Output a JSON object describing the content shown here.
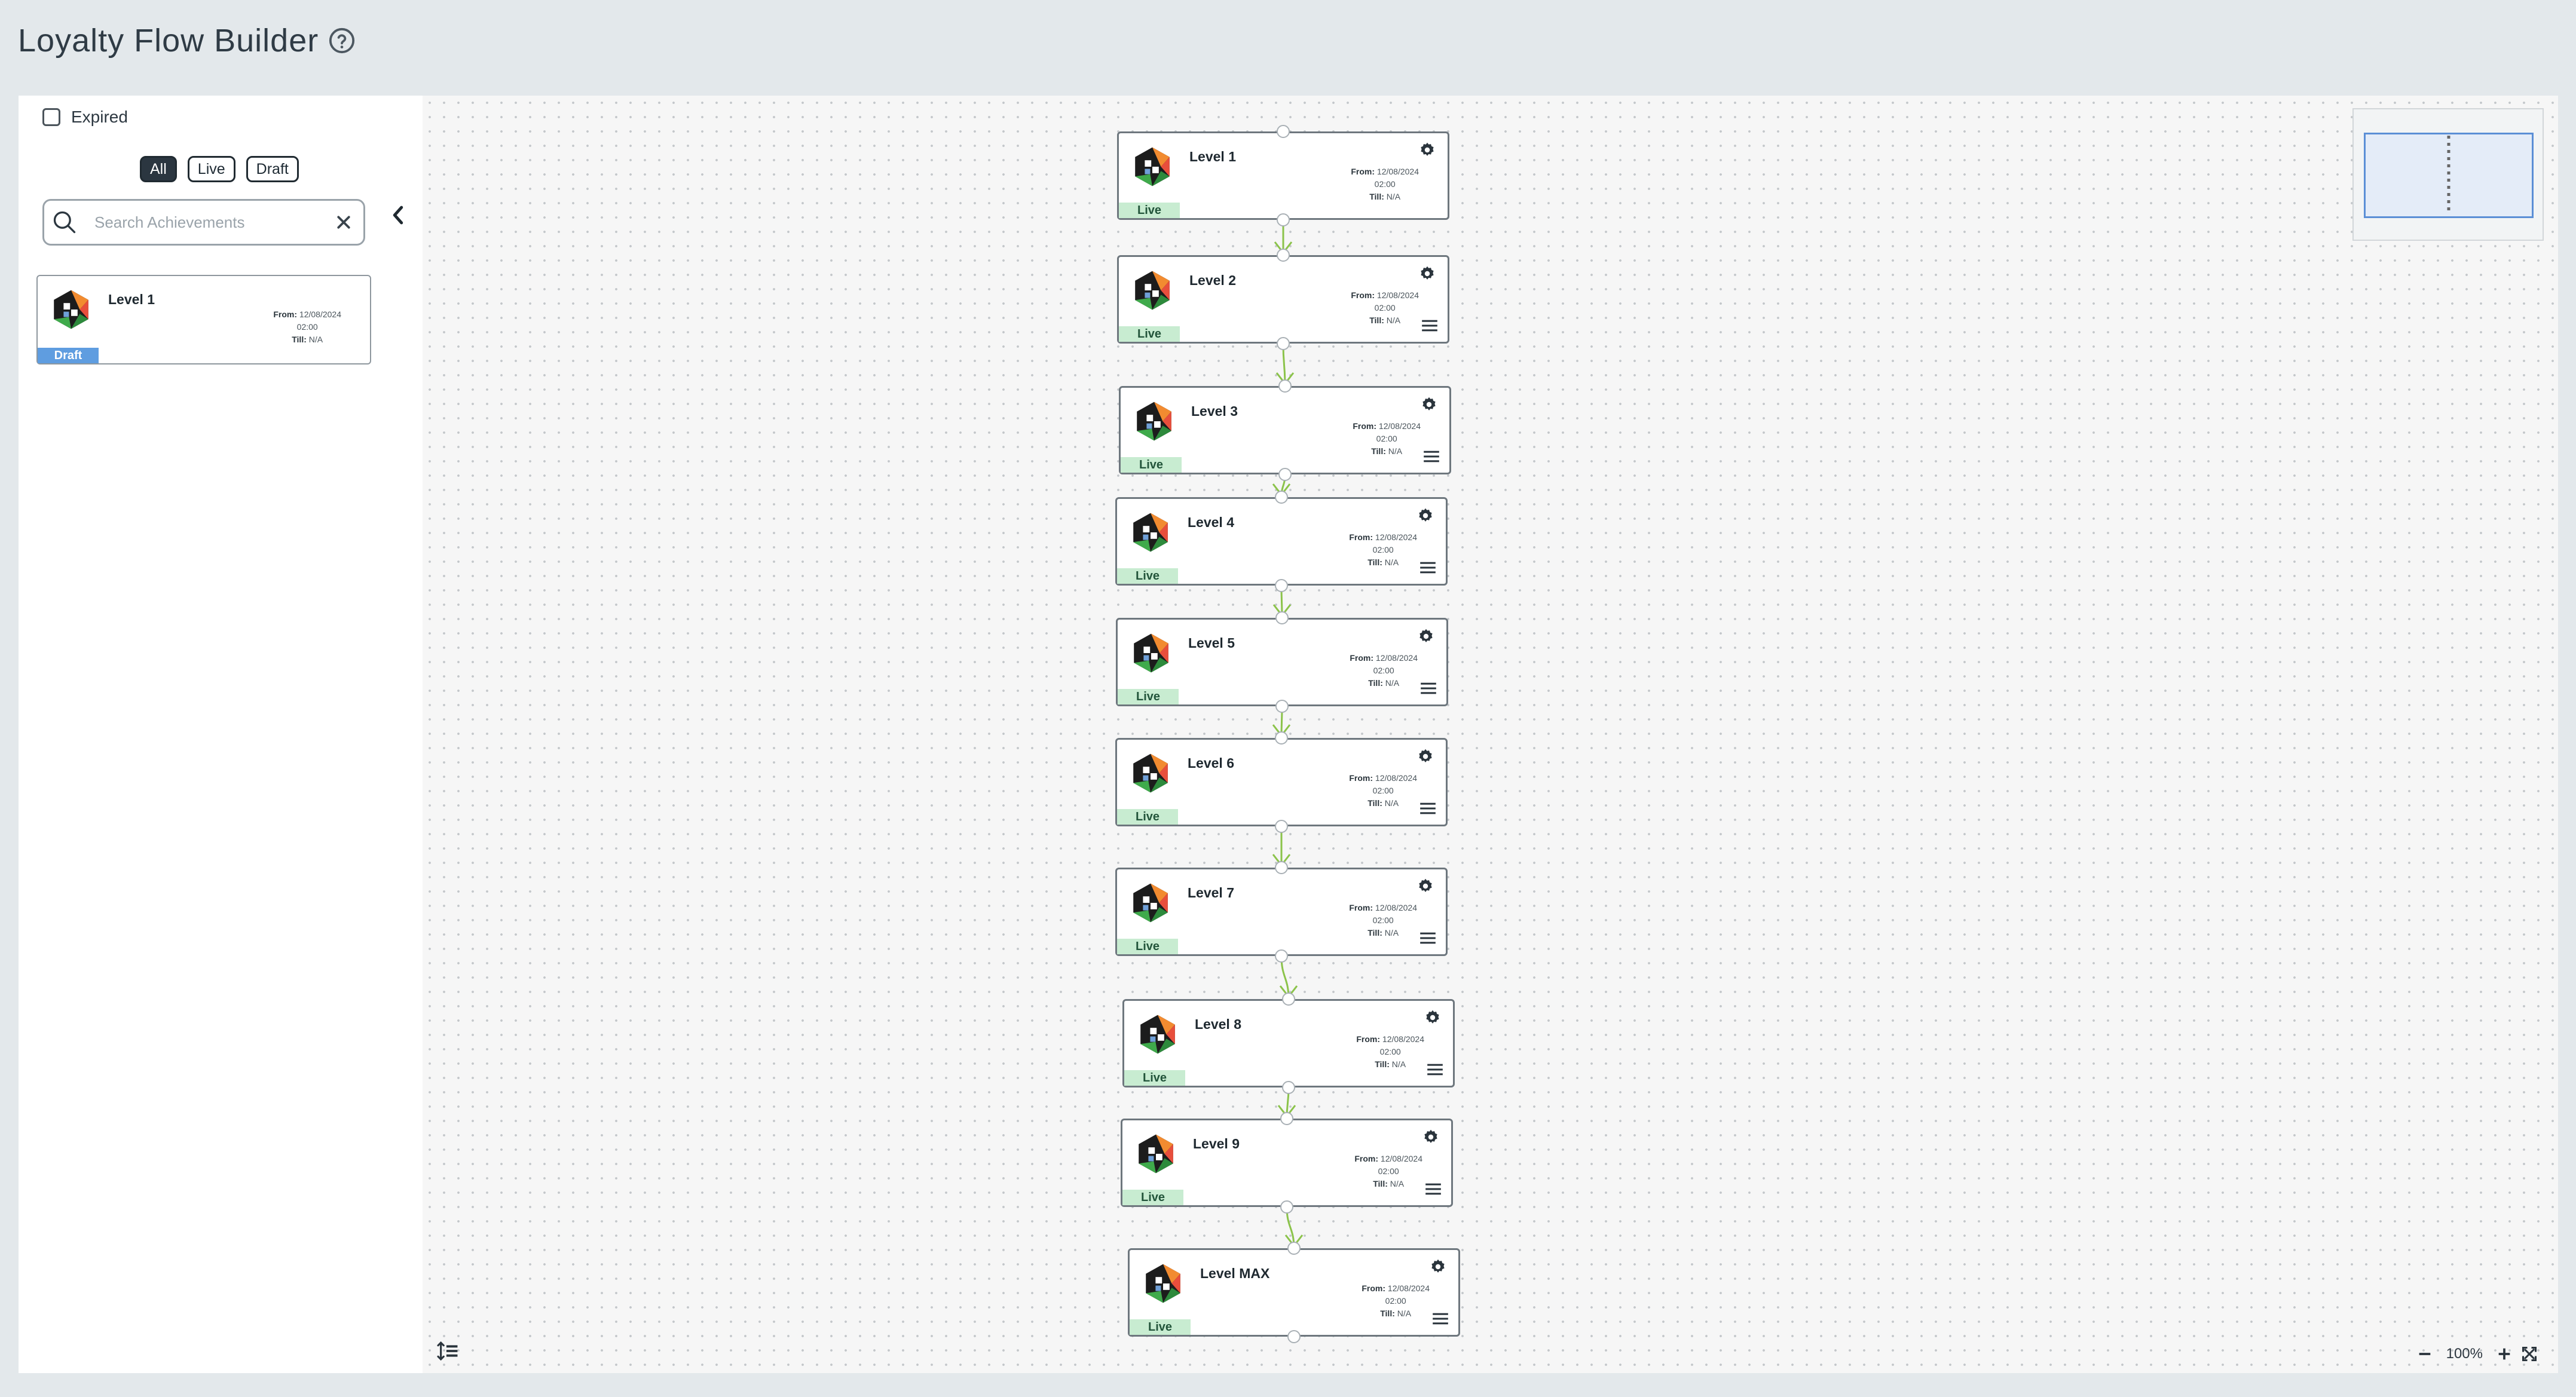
{
  "app": {
    "title": "Loyalty Flow Builder",
    "help_icon": "help-circle-icon"
  },
  "sidebar": {
    "expired_label": "Expired",
    "expired_checked": false,
    "filters": [
      {
        "label": "All",
        "active": true
      },
      {
        "label": "Live",
        "active": false
      },
      {
        "label": "Draft",
        "active": false
      }
    ],
    "search": {
      "placeholder": "Search Achievements",
      "value": ""
    },
    "cards": [
      {
        "title": "Level 1",
        "from_label": "From:",
        "from_date": "12/08/2024",
        "from_time": "02:00",
        "till_label": "Till:",
        "till_value": "N/A",
        "status": "Draft"
      }
    ]
  },
  "canvas": {
    "nodes": [
      {
        "title": "Level 1",
        "from_label": "From:",
        "from_date": "12/08/2024",
        "from_time": "02:00",
        "till_label": "Till:",
        "till_value": "N/A",
        "status": "Live",
        "has_menu": false
      },
      {
        "title": "Level 2",
        "from_label": "From:",
        "from_date": "12/08/2024",
        "from_time": "02:00",
        "till_label": "Till:",
        "till_value": "N/A",
        "status": "Live",
        "has_menu": true
      },
      {
        "title": "Level 3",
        "from_label": "From:",
        "from_date": "12/08/2024",
        "from_time": "02:00",
        "till_label": "Till:",
        "till_value": "N/A",
        "status": "Live",
        "has_menu": true
      },
      {
        "title": "Level 4",
        "from_label": "From:",
        "from_date": "12/08/2024",
        "from_time": "02:00",
        "till_label": "Till:",
        "till_value": "N/A",
        "status": "Live",
        "has_menu": true
      },
      {
        "title": "Level 5",
        "from_label": "From:",
        "from_date": "12/08/2024",
        "from_time": "02:00",
        "till_label": "Till:",
        "till_value": "N/A",
        "status": "Live",
        "has_menu": true
      },
      {
        "title": "Level 6",
        "from_label": "From:",
        "from_date": "12/08/2024",
        "from_time": "02:00",
        "till_label": "Till:",
        "till_value": "N/A",
        "status": "Live",
        "has_menu": true
      },
      {
        "title": "Level 7",
        "from_label": "From:",
        "from_date": "12/08/2024",
        "from_time": "02:00",
        "till_label": "Till:",
        "till_value": "N/A",
        "status": "Live",
        "has_menu": true
      },
      {
        "title": "Level 8",
        "from_label": "From:",
        "from_date": "12/08/2024",
        "from_time": "02:00",
        "till_label": "Till:",
        "till_value": "N/A",
        "status": "Live",
        "has_menu": true
      },
      {
        "title": "Level 9",
        "from_label": "From:",
        "from_date": "12/08/2024",
        "from_time": "02:00",
        "till_label": "Till:",
        "till_value": "N/A",
        "status": "Live",
        "has_menu": true
      },
      {
        "title": "Level MAX",
        "from_label": "From:",
        "from_date": "12/08/2024",
        "from_time": "02:00",
        "till_label": "Till:",
        "till_value": "N/A",
        "status": "Live",
        "has_menu": true
      }
    ],
    "edge_color": "#8bc34a",
    "zoom": "100%"
  },
  "colors": {
    "live_badge": "#c8ecd1",
    "draft_badge": "#5f9de0",
    "minimap_view": "#5b8fd6"
  }
}
